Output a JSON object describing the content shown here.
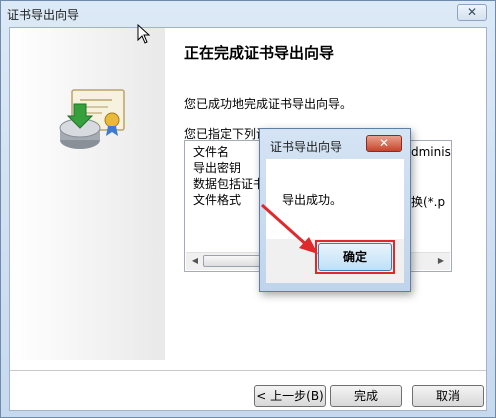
{
  "window": {
    "title": "证书导出向导",
    "close_label": "✕"
  },
  "wizard": {
    "heading": "正在完成证书导出向导",
    "completed_text": "您已成功地完成证书导出向导。",
    "settings_intro": "您已指定下列设置:",
    "settings_rows": [
      {
        "label": "文件名",
        "value": "dminis"
      },
      {
        "label": "导出密钥",
        "value": ""
      },
      {
        "label": "数据包括证书",
        "value": ""
      },
      {
        "label": "文件格式",
        "value": "换(*.p"
      }
    ]
  },
  "buttons": {
    "back": "< 上一步(B)",
    "finish": "完成",
    "cancel": "取消"
  },
  "popup": {
    "title": "证书导出向导",
    "close_label": "✕",
    "message": "导出成功。",
    "ok": "确定"
  },
  "colors": {
    "annotation_red": "#e0292c"
  },
  "icons": {
    "certificate": "certificate-export-icon",
    "cursor": "mouse-pointer-icon"
  }
}
